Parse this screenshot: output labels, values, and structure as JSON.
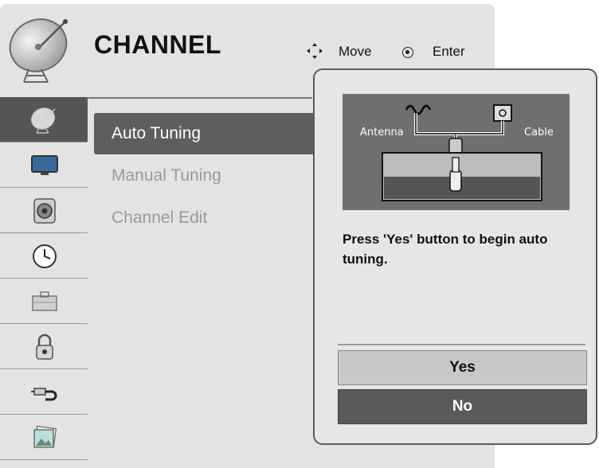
{
  "header": {
    "title": "CHANNEL",
    "hints": {
      "move_label": "Move",
      "enter_label": "Enter"
    },
    "icon": "satellite-dish-icon"
  },
  "categories": [
    {
      "name": "channel",
      "icon": "satellite-dish-icon",
      "selected": true
    },
    {
      "name": "picture",
      "icon": "tv-icon",
      "selected": false
    },
    {
      "name": "audio",
      "icon": "speaker-icon",
      "selected": false
    },
    {
      "name": "time",
      "icon": "clock-icon",
      "selected": false
    },
    {
      "name": "option",
      "icon": "toolbox-icon",
      "selected": false
    },
    {
      "name": "lock",
      "icon": "padlock-icon",
      "selected": false
    },
    {
      "name": "input",
      "icon": "cable-plug-icon",
      "selected": false
    },
    {
      "name": "media",
      "icon": "photo-icon",
      "selected": false
    }
  ],
  "submenu": {
    "items": [
      {
        "label": "Auto Tuning",
        "selected": true
      },
      {
        "label": "Manual Tuning",
        "selected": false
      },
      {
        "label": "Channel Edit",
        "selected": false
      }
    ]
  },
  "popup": {
    "diagram": {
      "antenna_label": "Antenna",
      "cable_label": "Cable"
    },
    "message": "Press 'Yes' button to begin auto tuning.",
    "yes_label": "Yes",
    "no_label": "No"
  },
  "colors": {
    "panel": "#e3e3e3",
    "selected": "#5e5e5e",
    "text_dim": "#9a9a9a"
  }
}
